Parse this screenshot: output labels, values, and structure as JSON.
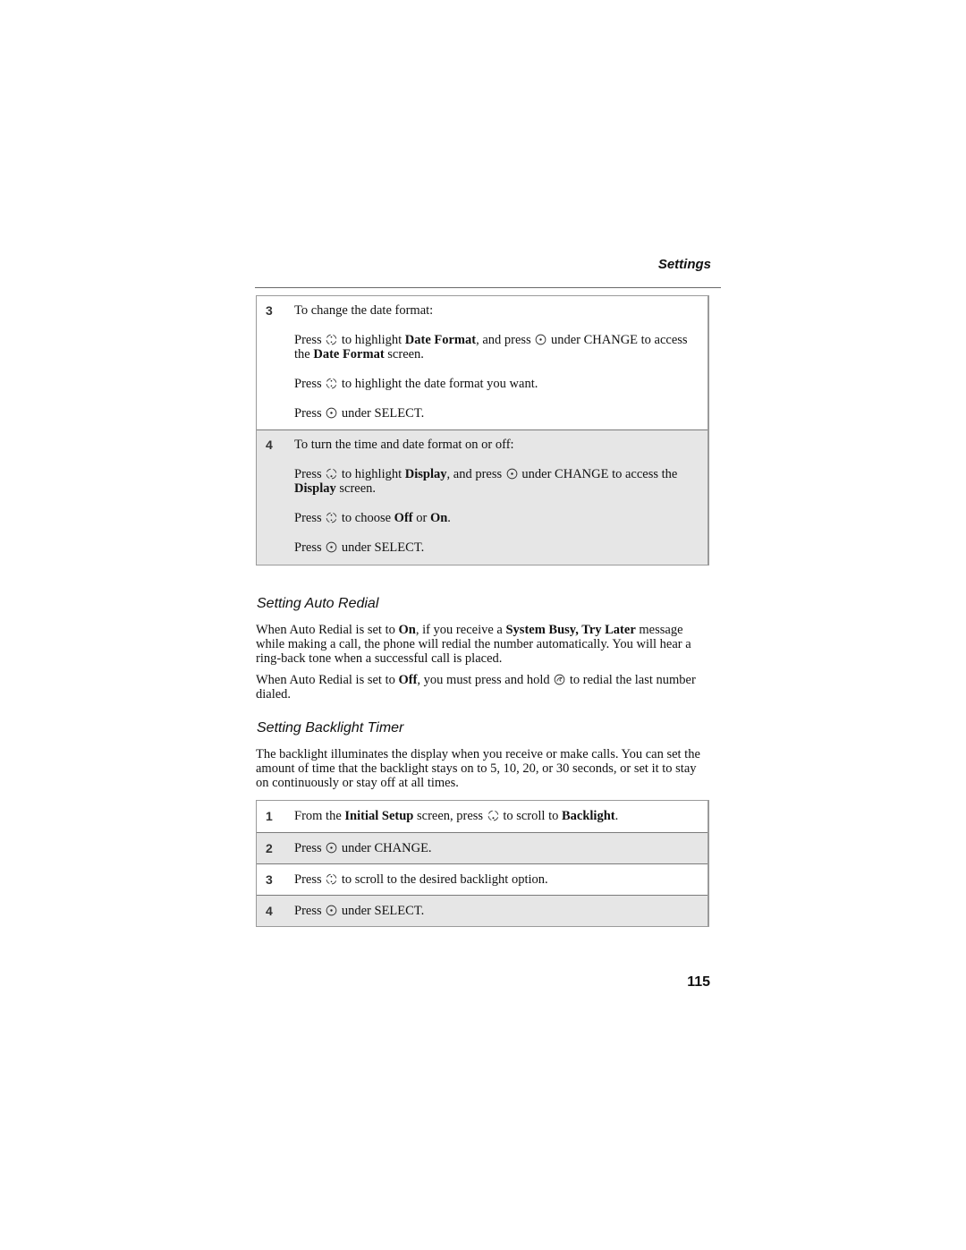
{
  "header": {
    "running_head": "Settings"
  },
  "date_steps": [
    {
      "number": "3",
      "intro": "To change the date format:",
      "lines": [
        {
          "pre": "Press",
          "icon": "nav-key-icon",
          "mid": "to highlight",
          "bold1": "Date Format",
          "mid2": ", and press",
          "icon2": "select-key-icon",
          "post": "under CHANGE to access the",
          "bold2": "Date Format",
          "end": "screen."
        },
        {
          "pre": "Press",
          "icon": "nav-key-icon",
          "post": "to highlight the date format you want."
        },
        {
          "pre": "Press",
          "icon": "select-key-icon",
          "post": "under SELECT."
        }
      ]
    },
    {
      "number": "4",
      "intro": "To turn the time and date format on or off:",
      "lines": [
        {
          "pre": "Press",
          "icon": "nav-down-key-icon",
          "mid": "to highlight",
          "bold1": "Display",
          "mid2": ", and press",
          "icon2": "select-key-icon",
          "post": "under CHANGE to access the",
          "bold2": "Display",
          "end": "screen."
        },
        {
          "pre": "Press",
          "icon": "nav-key-icon",
          "mid": "to choose",
          "bold1": "Off",
          "mid2": "or",
          "bold2": "On",
          "end": "."
        },
        {
          "pre": "Press",
          "icon": "select-key-icon",
          "post": "under SELECT."
        }
      ]
    }
  ],
  "auto_redial": {
    "title": "Setting Auto Redial",
    "para1": {
      "t1": "When Auto Redial is set to",
      "b1": "On",
      "t2": ", if you receive a",
      "b2": "System Busy, Try Later",
      "t3": "message while making a call, the phone will redial the number automatically. You will hear a ring-back tone when a successful call is placed."
    },
    "para2": {
      "t1": "When Auto Redial is set to",
      "b1": "Off",
      "t2": ", you must press and hold",
      "icon": "send-key-icon",
      "t3": "to redial the last number dialed."
    }
  },
  "backlight": {
    "title": "Setting Backlight Timer",
    "para": "The backlight illuminates the display when you receive or make calls. You can set the amount of time that the backlight stays on to 5, 10, 20, or 30 seconds, or set it to stay on continuously or stay off at all times.",
    "steps": [
      {
        "number": "1",
        "t1": "From the",
        "b1": "Initial Setup",
        "t2": "screen, press",
        "icon": "nav-down-key-icon",
        "t3": "to scroll to",
        "b2": "Backlight",
        "t4": "."
      },
      {
        "number": "2",
        "t1": "Press",
        "icon": "select-key-icon",
        "t2": "under CHANGE."
      },
      {
        "number": "3",
        "t1": "Press",
        "icon": "nav-key-icon",
        "t2": "to scroll to the desired backlight option."
      },
      {
        "number": "4",
        "t1": "Press",
        "icon": "select-key-icon",
        "t2": "under SELECT."
      }
    ]
  },
  "footer": {
    "page_number": "115"
  }
}
